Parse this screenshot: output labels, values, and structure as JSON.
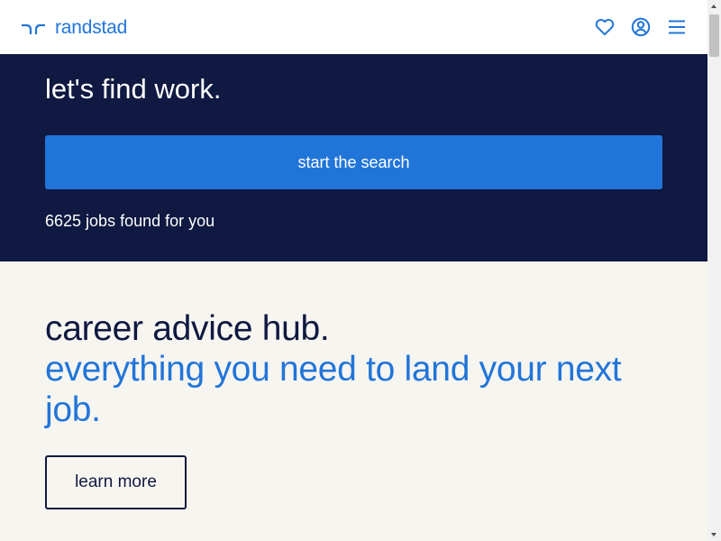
{
  "header": {
    "logo_text": "randstad",
    "favorites_icon": "heart-icon",
    "account_icon": "user-circle-icon",
    "menu_icon": "hamburger-menu-icon"
  },
  "hero": {
    "title": "let's find work.",
    "search_button_label": "start the search",
    "jobs_count_text": "6625 jobs found for you"
  },
  "career": {
    "title_line": "career advice hub.",
    "subtitle": "everything you need to land your next job.",
    "learn_more_label": "learn more"
  },
  "colors": {
    "brand_blue": "#2175d9",
    "navy": "#0f1941",
    "off_white": "#f7f5f0"
  }
}
